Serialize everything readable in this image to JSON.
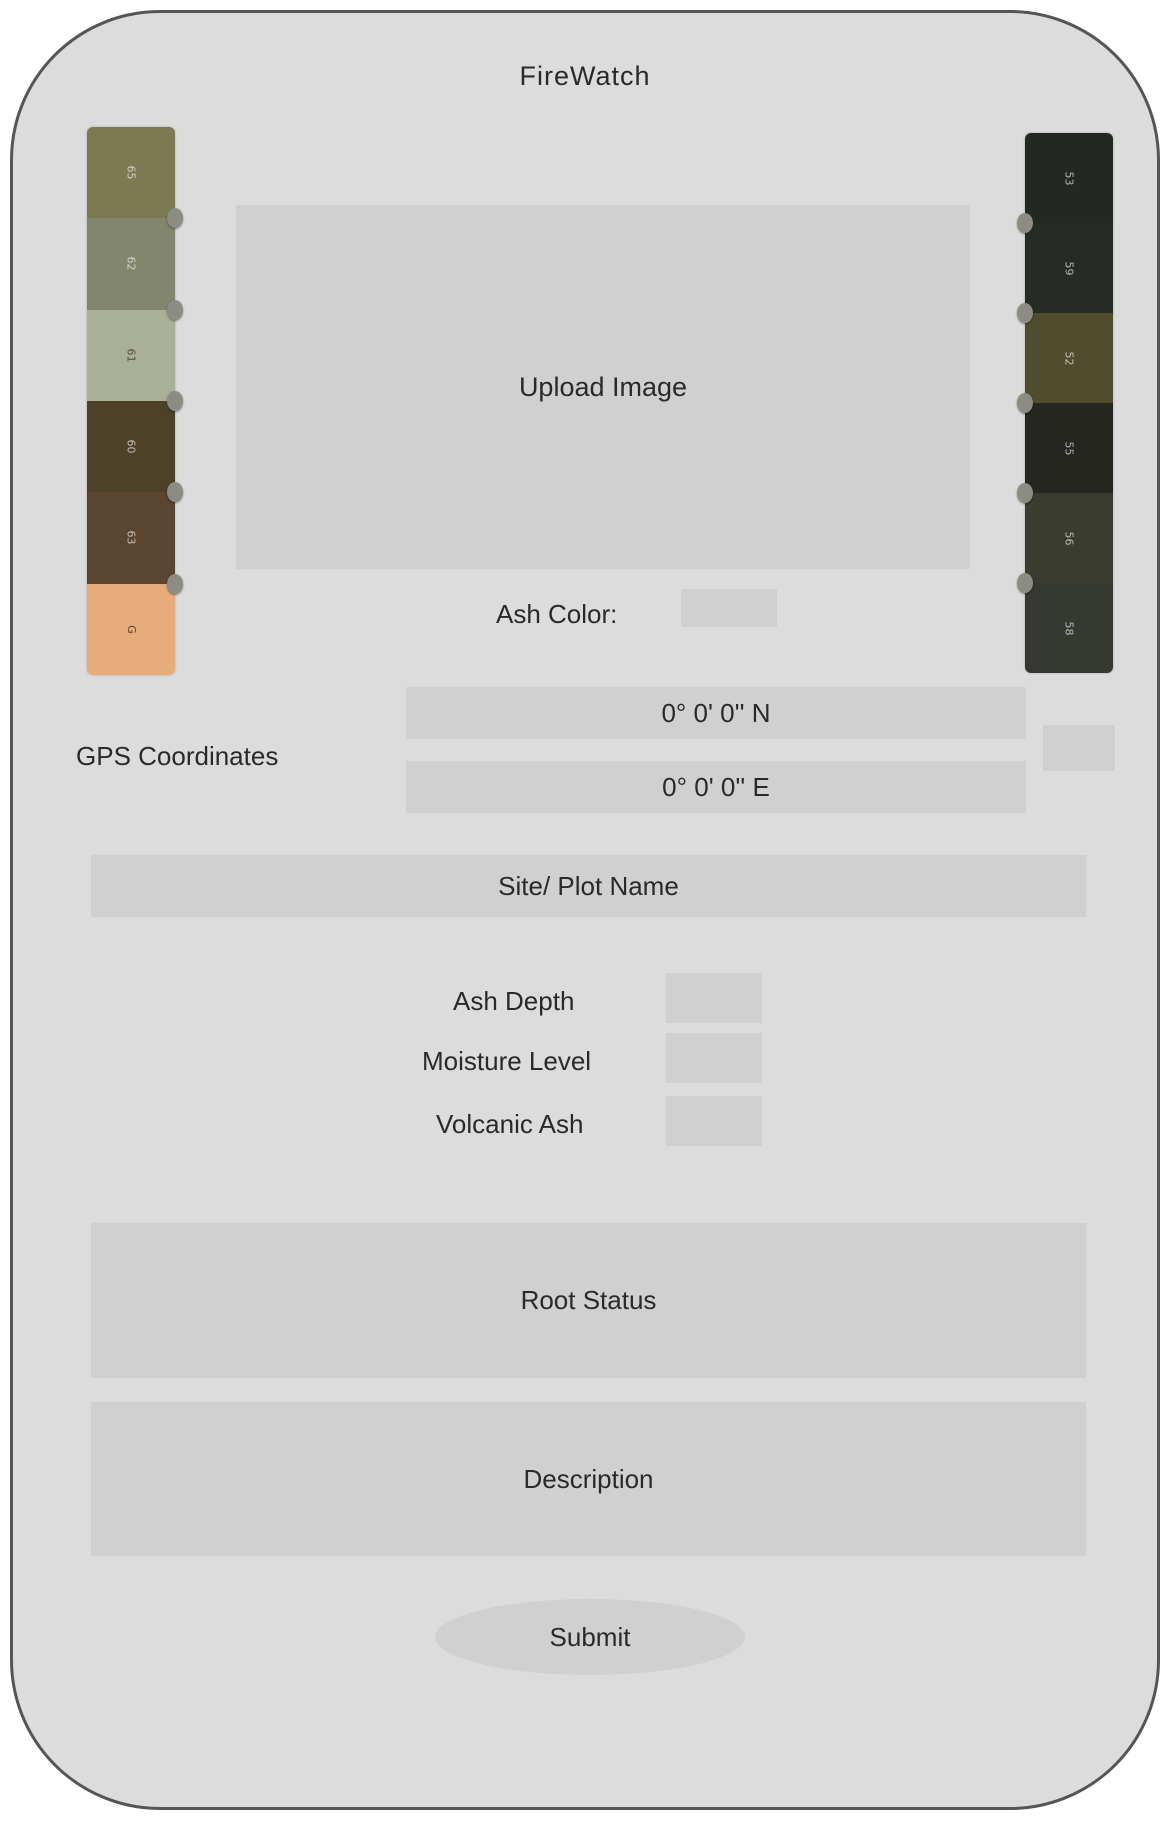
{
  "app": {
    "title": "FireWatch"
  },
  "upload": {
    "label": "Upload Image"
  },
  "ash_color": {
    "label": "Ash Color:",
    "value": ""
  },
  "color_chart": {
    "left": [
      {
        "num": "65",
        "color": "#7b7a52"
      },
      {
        "num": "62",
        "color": "#82866c"
      },
      {
        "num": "61",
        "color": "#a9b096"
      },
      {
        "num": "60",
        "color": "#4d4228"
      },
      {
        "num": "63",
        "color": "#5a4530"
      },
      {
        "num": "G",
        "color": "#e6ac7c"
      }
    ],
    "right": [
      {
        "num": "53",
        "color": "#232822"
      },
      {
        "num": "59",
        "color": "#272b26"
      },
      {
        "num": "52",
        "color": "#504d2e"
      },
      {
        "num": "55",
        "color": "#24261f"
      },
      {
        "num": "56",
        "color": "#3a3c30"
      },
      {
        "num": "58",
        "color": "#363932"
      }
    ]
  },
  "gps": {
    "label": "GPS Coordinates",
    "latitude": "0° 0' 0'' N",
    "longitude": "0° 0' 0'' E"
  },
  "site": {
    "placeholder": "Site/ Plot Name"
  },
  "measurements": [
    {
      "label": "Ash Depth",
      "value": ""
    },
    {
      "label": "Moisture Level",
      "value": ""
    },
    {
      "label": "Volcanic Ash",
      "value": ""
    }
  ],
  "root_status": {
    "placeholder": "Root Status"
  },
  "description": {
    "placeholder": "Description"
  },
  "submit": {
    "label": "Submit"
  },
  "colors": {
    "background": "#dcdcdc",
    "field": "#d0d0d0",
    "frame_border": "#555555",
    "text": "#2a2a2a"
  }
}
